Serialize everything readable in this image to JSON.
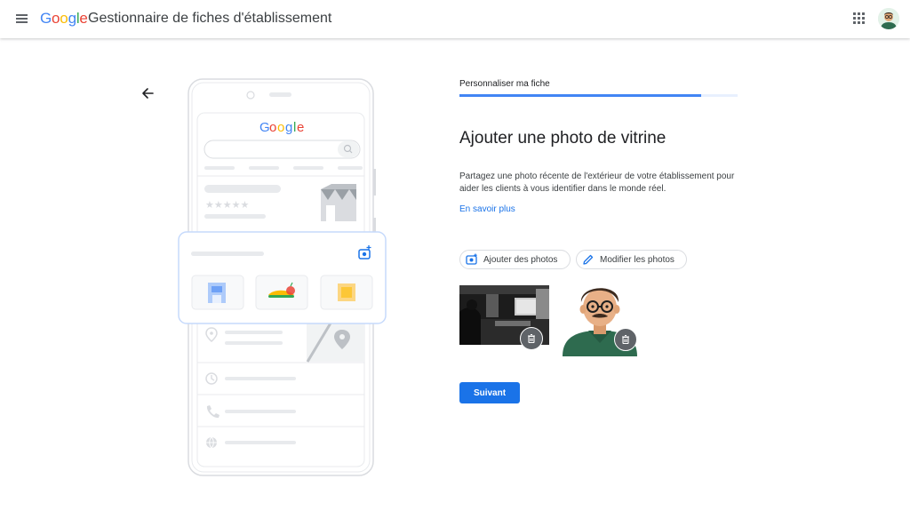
{
  "header": {
    "logo_letters": [
      "G",
      "o",
      "o",
      "g",
      "l",
      "e"
    ],
    "logo_colors": [
      "#4285f4",
      "#ea4335",
      "#fbbc05",
      "#4285f4",
      "#34a853",
      "#ea4335"
    ],
    "title": "Gestionnaire de fiches d'établissement",
    "menu_icon": "hamburger-menu-icon",
    "apps_icon": "apps-grid-icon",
    "account_icon": "user-avatar"
  },
  "illustration": {
    "search_logo": "Google",
    "icons": [
      "add-photo-icon",
      "location-pin-icon",
      "clock-icon",
      "phone-icon",
      "globe-icon",
      "storefront-icon",
      "map-pin-icon"
    ]
  },
  "main": {
    "step_label": "Personnaliser ma fiche",
    "progress": 0.87,
    "heading": "Ajouter une photo de vitrine",
    "description": "Partagez une photo récente de l'extérieur de votre établissement pour aider les clients à vous identifier dans le monde réel.",
    "learn_more": "En savoir plus",
    "add_photos": "Ajouter des photos",
    "edit_photos": "Modifier les photos",
    "next": "Suivant"
  },
  "colors": {
    "accent": "#1a73e8",
    "progress_fill": "#4285f4",
    "progress_track": "#e8f0fe",
    "delete_button": "#5f6368"
  }
}
